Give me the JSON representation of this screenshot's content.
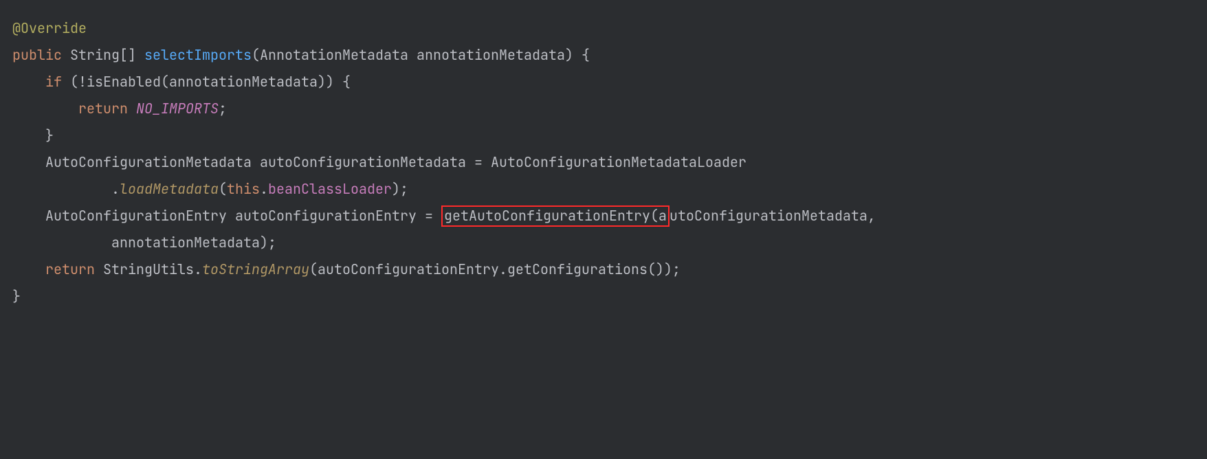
{
  "code": {
    "l1": {
      "annotation": "@Override"
    },
    "l2": {
      "kw": "public",
      "type": "String[]",
      "method": "selectImports",
      "paramType": "AnnotationMetadata",
      "paramName": "annotationMetadata"
    },
    "l3": {
      "kw": "if",
      "rest": "(!isEnabled(annotationMetadata)) {"
    },
    "l4": {
      "kw": "return",
      "val": "NO_IMPORTS"
    },
    "l6": {
      "type": "AutoConfigurationMetadata",
      "var": "autoConfigurationMetadata",
      "rhs": "AutoConfigurationMetadataLoader"
    },
    "l7": {
      "method": "loadMetadata",
      "this": "this",
      "field": "beanClassLoader"
    },
    "l8": {
      "type": "AutoConfigurationEntry",
      "var": "autoConfigurationEntry",
      "hl": "getAutoConfigurationEntry(a",
      "arg1": "utoConfigurationMetadata"
    },
    "l9": {
      "arg": "annotationMetadata"
    },
    "l10": {
      "kw": "return",
      "cls": "StringUtils",
      "method": "toStringArray",
      "args": "(autoConfigurationEntry.getConfigurations());"
    }
  },
  "highlight": {
    "color": "#ff2a2a",
    "target": "getAutoConfigurationEntry("
  },
  "colors": {
    "background": "#2b2d30",
    "text": "#bcbec4",
    "annotation": "#b3ae60",
    "keyword": "#cf8e6d",
    "function": "#57aaf7",
    "field": "#c77dbb",
    "staticMethod": "#b09765"
  }
}
